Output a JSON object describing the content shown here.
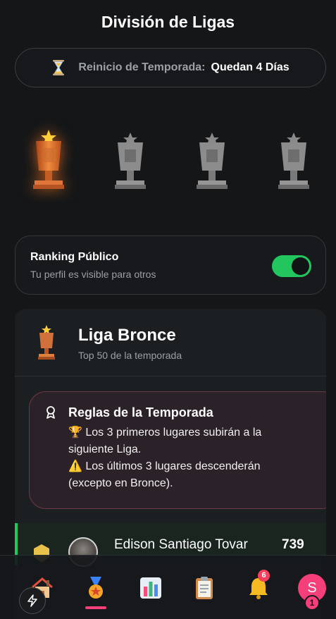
{
  "header": {
    "title": "División de Ligas"
  },
  "season": {
    "icon": "hourglass-icon",
    "label": "Reinicio de Temporada:",
    "value": "Quedan 4 Días"
  },
  "trophies": [
    {
      "icon": "bronze-trophy-icon",
      "state": "active"
    },
    {
      "icon": "silver-trophy-icon",
      "state": "locked"
    },
    {
      "icon": "gold-trophy-icon",
      "state": "locked"
    },
    {
      "icon": "diamond-trophy-icon",
      "state": "locked"
    }
  ],
  "ranking": {
    "title": "Ranking Público",
    "subtitle": "Tu perfil es visible para otros",
    "enabled": true
  },
  "league": {
    "icon": "bronze-trophy-icon",
    "name": "Liga Bronce",
    "subtitle": "Top 50 de la temporada"
  },
  "rules": {
    "icon": "ribbon-icon",
    "title": "Reglas de la Temporada",
    "line1": "🏆 Los 3 primeros lugares subirán a la siguiente Liga.",
    "line2": "⚠️ Los últimos 3 lugares descenderán (excepto en Bronce)."
  },
  "leaderboard": [
    {
      "name": "Edison Santiago Tovar",
      "score": "739"
    }
  ],
  "bottom_nav": {
    "items": [
      {
        "icon": "home-icon"
      },
      {
        "icon": "medal-icon",
        "active": true
      },
      {
        "icon": "stats-icon"
      },
      {
        "icon": "clipboard-icon"
      },
      {
        "icon": "bell-icon",
        "badge": "6"
      },
      {
        "icon": "profile-avatar",
        "initial": "S",
        "badge": "1"
      }
    ]
  },
  "colors": {
    "accent_green": "#22c55e",
    "accent_pink": "#f43f7a",
    "background": "#141618"
  }
}
